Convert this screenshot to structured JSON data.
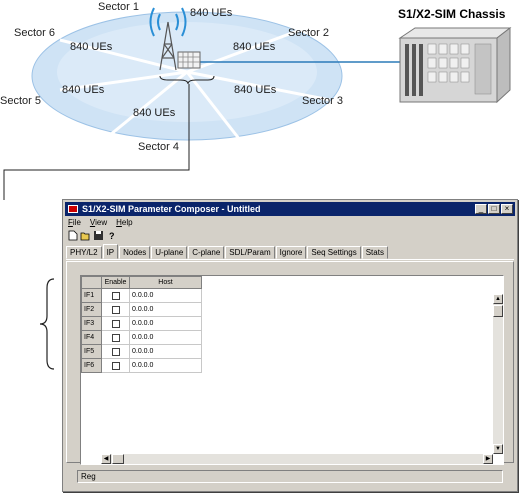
{
  "diagram": {
    "sectors": [
      "Sector 1",
      "Sector 2",
      "Sector 3",
      "Sector 4",
      "Sector 5",
      "Sector 6"
    ],
    "ue_label": "840 UEs",
    "chassis_title": "S1/X2-SIM Chassis",
    "colors": {
      "disk": "#cfe3f5",
      "disk_edge": "#9cc2e6",
      "link": "#2b7bb9",
      "signal": "#2a8fd6"
    }
  },
  "window": {
    "title": "S1/X2-SIM Parameter Composer - Untitled",
    "controls": [
      "_",
      "□",
      "×"
    ],
    "menu": [
      {
        "label": "File",
        "accel": "F",
        "rest": "ile"
      },
      {
        "label": "View",
        "accel": "V",
        "rest": "iew"
      },
      {
        "label": "Help",
        "accel": "H",
        "rest": "elp"
      }
    ],
    "toolbar": [
      "new-icon",
      "open-icon",
      "save-icon",
      "help-icon"
    ],
    "tabs": [
      "PHY/L2",
      "IP",
      "Nodes",
      "U-plane",
      "C-plane",
      "SDL/Param",
      "Ignore",
      "Seq Settings",
      "Stats"
    ],
    "active_tab": "IP",
    "grid": {
      "headers": [
        "",
        "Enable",
        "Host"
      ],
      "rows": [
        {
          "label": "IF1",
          "host": "0.0.0.0"
        },
        {
          "label": "IF2",
          "host": "0.0.0.0"
        },
        {
          "label": "IF3",
          "host": "0.0.0.0"
        },
        {
          "label": "IF4",
          "host": "0.0.0.0"
        },
        {
          "label": "IF5",
          "host": "0.0.0.0"
        },
        {
          "label": "IF6",
          "host": "0.0.0.0"
        }
      ]
    },
    "status": "Reg"
  }
}
